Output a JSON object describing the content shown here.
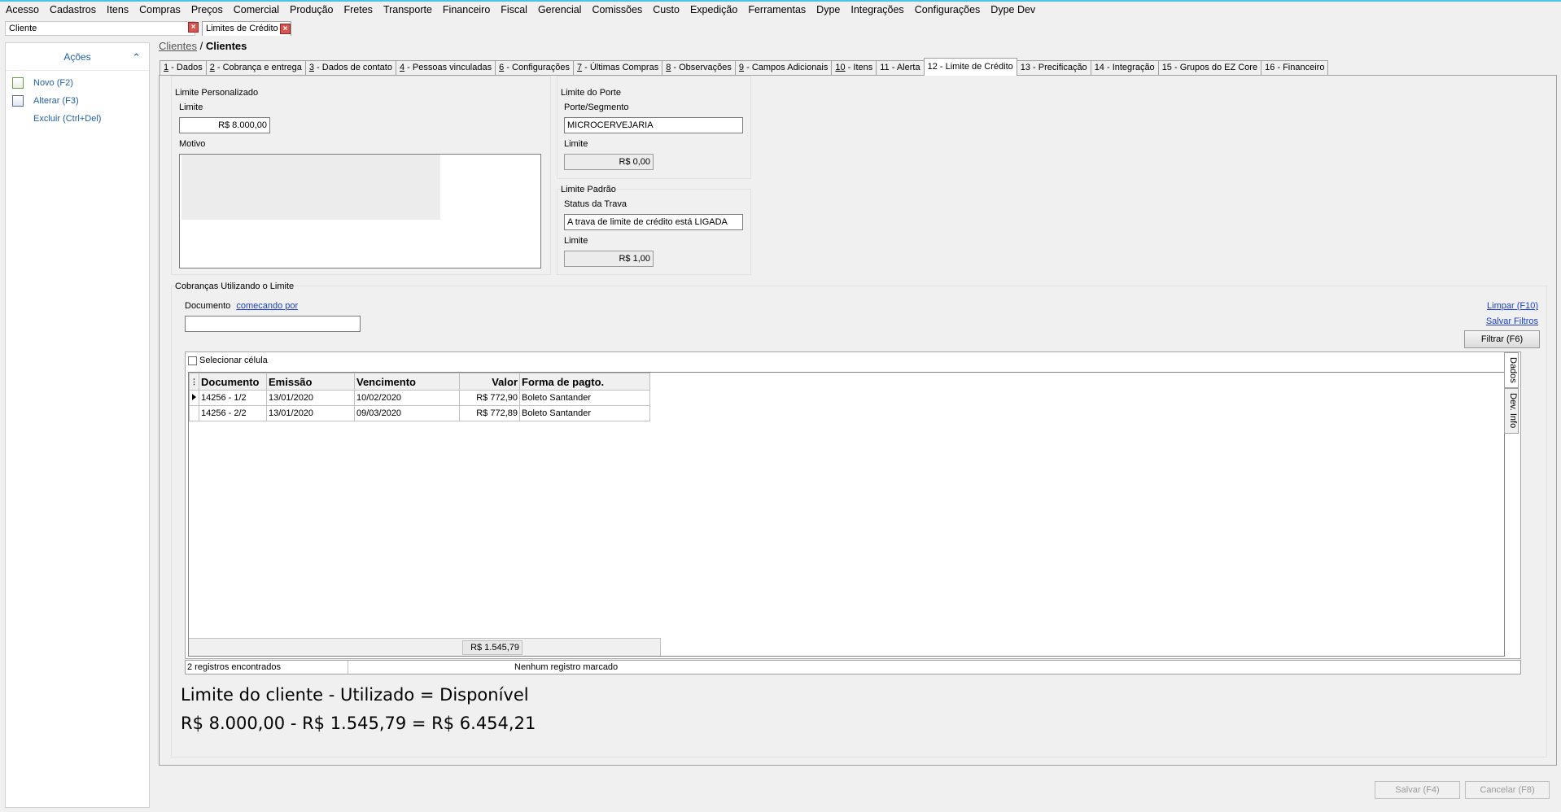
{
  "menu": [
    "Acesso",
    "Cadastros",
    "Itens",
    "Compras",
    "Preços",
    "Comercial",
    "Produção",
    "Fretes",
    "Transporte",
    "Financeiro",
    "Fiscal",
    "Gerencial",
    "Comissões",
    "Custo",
    "Expedição",
    "Ferramentas",
    "Dype",
    "Integrações",
    "Configurações",
    "Dype Dev"
  ],
  "search": {
    "value": "Cliente"
  },
  "doc_tab": {
    "label": "Limites de Crédito"
  },
  "sidebar": {
    "header": "Ações",
    "actions": [
      {
        "label": "Novo (F2)",
        "icon": "new-document-icon"
      },
      {
        "label": "Alterar (F3)",
        "icon": "edit-document-icon"
      },
      {
        "label": "Excluir (Ctrl+Del)",
        "icon": ""
      }
    ]
  },
  "breadcrumb": {
    "parent": "Clientes",
    "separator": " / ",
    "current": "Clientes"
  },
  "tabs": [
    {
      "num": "1",
      "label": " - Dados"
    },
    {
      "num": "2",
      "label": " - Cobrança e entrega"
    },
    {
      "num": "3",
      "label": " - Dados de contato"
    },
    {
      "num": "4",
      "label": " - Pessoas vinculadas"
    },
    {
      "num": "6",
      "label": " - Configurações"
    },
    {
      "num": "7",
      "label": " - Últimas Compras"
    },
    {
      "num": "8",
      "label": " - Observações"
    },
    {
      "num": "9",
      "label": " - Campos Adicionais"
    },
    {
      "num": "10",
      "label": " - Itens"
    },
    {
      "num": "",
      "label": "11 - Alerta"
    },
    {
      "num": "",
      "label": "12 - Limite de Crédito"
    },
    {
      "num": "",
      "label": "13 - Precificação"
    },
    {
      "num": "",
      "label": "14 - Integração"
    },
    {
      "num": "",
      "label": "15 - Grupos do EZ Core"
    },
    {
      "num": "",
      "label": "16 - Financeiro"
    }
  ],
  "active_tab_index": 10,
  "limite_personalizado": {
    "title": "Limite Personalizado",
    "limite_label": "Limite",
    "limite_value": "R$ 8.000,00",
    "motivo_label": "Motivo"
  },
  "limite_porte": {
    "title": "Limite do Porte",
    "porte_label": "Porte/Segmento",
    "porte_value": "MICROCERVEJARIA",
    "limite_label": "Limite",
    "limite_value": "R$ 0,00"
  },
  "limite_padrao": {
    "title": "Limite Padrão",
    "status_label": "Status da Trava",
    "status_value": "A trava de limite de crédito está LIGADA",
    "limite_label": "Limite",
    "limite_value": "R$ 1,00"
  },
  "cobrancas": {
    "title": "Cobranças Utilizando o Limite",
    "documento_label": "Documento",
    "documento_mode": "comecando por",
    "documento_value": "",
    "limpar": "Limpar (F10)",
    "salvar_filtros": "Salvar Filtros",
    "filtrar": "Filtrar (F6)",
    "selecionar_celula": "Selecionar célula",
    "columns": [
      "Documento",
      "Emissão",
      "Vencimento",
      "Valor",
      "Forma de pagto."
    ],
    "rows": [
      [
        "14256 - 1/2",
        "13/01/2020",
        "10/02/2020",
        "R$ 772,90",
        "Boleto Santander"
      ],
      [
        "14256 - 2/2",
        "13/01/2020",
        "09/03/2020",
        "R$ 772,89",
        "Boleto Santander"
      ]
    ],
    "total": "R$ 1.545,79",
    "side_tabs": [
      "Dados",
      "Dev. Info"
    ],
    "status_left": "2 registros encontrados",
    "status_right": "Nenhum registro marcado"
  },
  "summary": {
    "formula": "Limite do cliente - Utilizado = Disponível",
    "values": "R$ 8.000,00 - R$ 1.545,79 = R$ 6.454,21"
  },
  "footer": {
    "save": "Salvar (F4)",
    "cancel": "Cancelar (F8)"
  }
}
